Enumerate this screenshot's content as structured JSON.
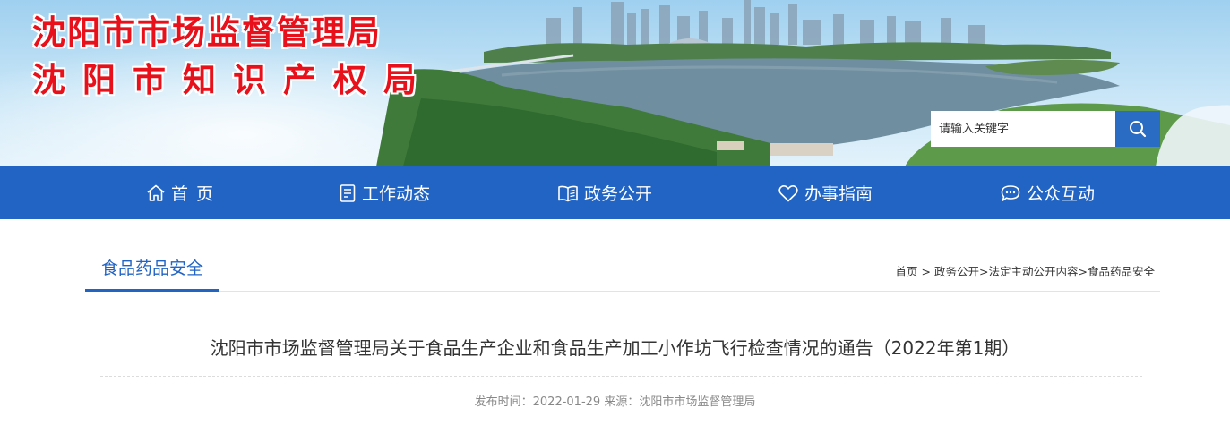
{
  "header": {
    "site_name_line1": "沈阳市市场监督管理局",
    "site_name_line2": "沈阳市知识产权局",
    "search": {
      "placeholder": "请输入关键字",
      "button_icon": "search-icon"
    }
  },
  "nav": {
    "items": [
      {
        "label": "首页",
        "icon": "home-icon"
      },
      {
        "label": "工作动态",
        "icon": "document-icon"
      },
      {
        "label": "政务公开",
        "icon": "book-icon"
      },
      {
        "label": "办事指南",
        "icon": "heart-icon"
      },
      {
        "label": "公众互动",
        "icon": "chat-icon"
      }
    ]
  },
  "column": {
    "title": "食品药品安全",
    "breadcrumb": [
      "首页",
      "政务公开",
      "法定主动公开内容",
      "食品药品安全"
    ],
    "breadcrumb_separators": [
      " > ",
      ">",
      ">"
    ]
  },
  "article": {
    "title": "沈阳市市场监督管理局关于食品生产企业和食品生产加工小作坊飞行检查情况的通告（2022年第1期）",
    "publish_label": "发布时间：",
    "publish_date": "2022-01-29",
    "source_label": "来源：",
    "source": "沈阳市市场监督管理局"
  },
  "colors": {
    "nav_bg": "#2164c4",
    "site_name": "#e8101a",
    "accent": "#2164c4"
  }
}
